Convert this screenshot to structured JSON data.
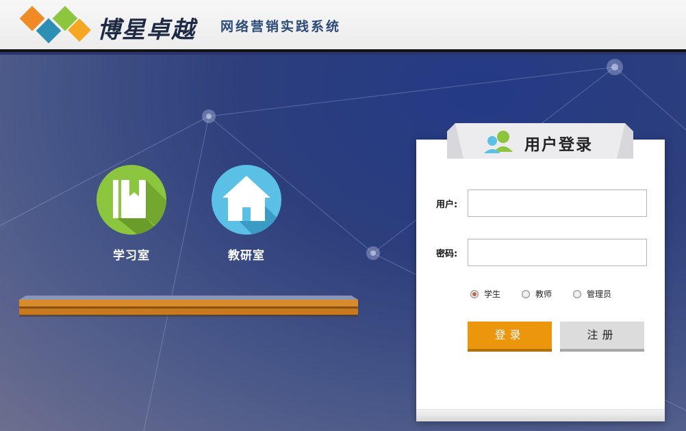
{
  "header": {
    "brand_name": "博星卓越",
    "system_name": "网络营销实践系统"
  },
  "nav": {
    "items": [
      {
        "label": "学习室",
        "icon": "book-icon",
        "color": "#8cc63f"
      },
      {
        "label": "教研室",
        "icon": "home-icon",
        "color": "#5bc0e6"
      }
    ]
  },
  "login": {
    "title": "用户登录",
    "username_label": "用户:",
    "username_value": "",
    "password_label": "密码:",
    "password_value": "",
    "roles": [
      {
        "label": "学生",
        "selected": true
      },
      {
        "label": "教师",
        "selected": false
      },
      {
        "label": "管理员",
        "selected": false
      }
    ],
    "login_button": "登录",
    "register_button": "注册"
  },
  "colors": {
    "login_button": "#ec960d",
    "register_button": "#dcdcdc",
    "accent_green": "#8cc63f",
    "accent_blue": "#5bc0e6"
  }
}
